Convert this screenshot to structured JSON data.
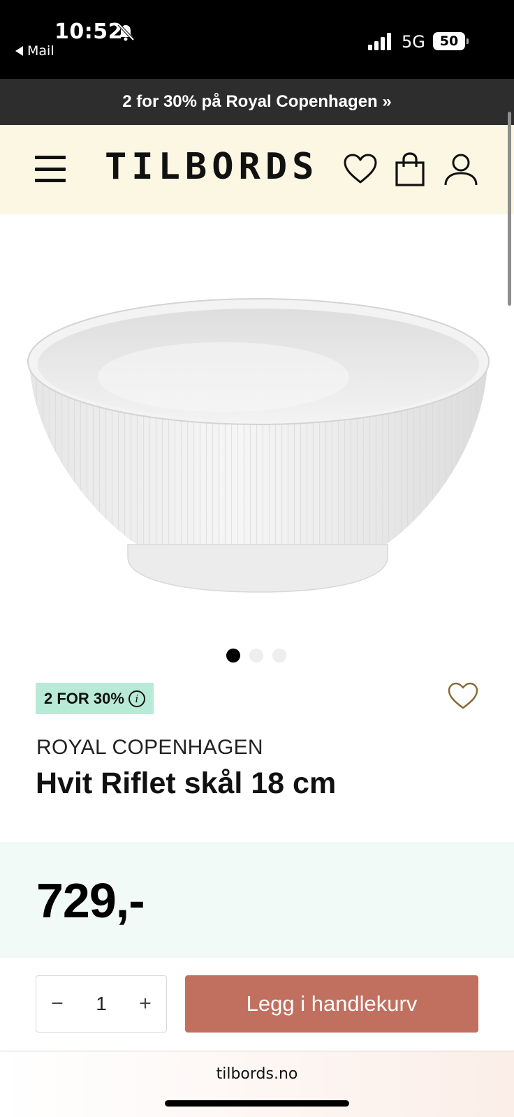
{
  "status_bar": {
    "time": "10:52",
    "back_label": "Mail",
    "network": "5G",
    "battery": "50"
  },
  "promo": {
    "text": "2 for 30% på Royal Copenhagen »"
  },
  "header": {
    "logo": "TILBORDS",
    "icons": [
      "menu-icon",
      "heart-icon",
      "shopping-bag-icon",
      "user-icon"
    ]
  },
  "gallery": {
    "image": "white-fluted-bowl",
    "dots_total": 3,
    "active_dot": 1
  },
  "product": {
    "badge": "2 FOR 30%",
    "badge_info": "i",
    "brand": "ROYAL COPENHAGEN",
    "name": "Hvit Riflet skål 18 cm",
    "price": "729,-"
  },
  "purchase": {
    "minus": "−",
    "quantity": "1",
    "plus": "+",
    "add_to_cart": "Legg i handlekurv"
  },
  "browser": {
    "url": "tilbords.no"
  },
  "colors": {
    "promo_bg": "#2d2d2d",
    "header_bg": "#fcf7e3",
    "badge_bg": "#b8ebd7",
    "price_band_bg": "#f1faf7",
    "cta_bg": "#c17060",
    "fav_heart": "#8a6a3a"
  }
}
